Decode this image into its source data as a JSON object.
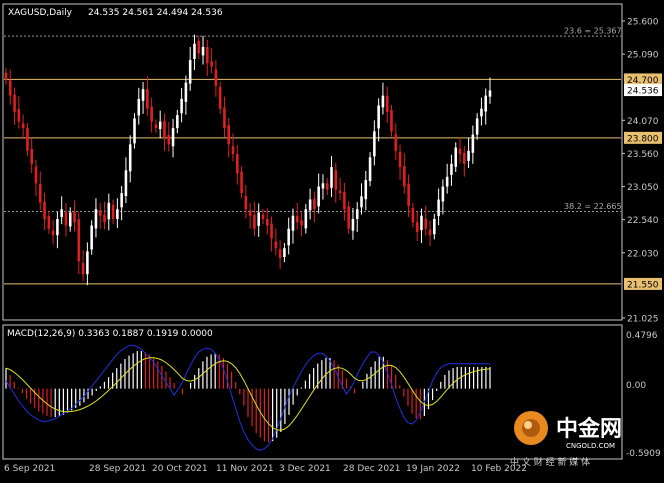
{
  "header": {
    "symbol": "XAGUSD,Daily",
    "ohlc": "24.535 24.561 24.494 24.536"
  },
  "macd": {
    "label": "MACD(12,26,9) 0.3363 0.1887 0.1919 0.0000",
    "axis_top": "0.4796",
    "axis_zero": "0.00",
    "axis_bottom": "-0.5909"
  },
  "chart_data": {
    "type": "candlestick",
    "price_axis_ticks": [
      "25.600",
      "25.090",
      "24.070",
      "23.560",
      "23.050",
      "22.540",
      "22.030",
      "21.025"
    ],
    "ylim": [
      21.025,
      25.6
    ],
    "x_ticks": [
      "6 Sep 2021",
      "28 Sep 2021",
      "20 Oct 2021",
      "11 Nov 2021",
      "3 Dec 2021",
      "28 Dec 2021",
      "19 Jan 2022",
      "10 Feb 2022"
    ],
    "levels": [
      {
        "label": "24.700",
        "value": 24.7,
        "style": "solid",
        "color": "#e8c070"
      },
      {
        "label": "23.800",
        "value": 23.8,
        "style": "solid",
        "color": "#e8c070"
      },
      {
        "label": "21.550",
        "value": 21.55,
        "style": "solid",
        "color": "#e8c070"
      },
      {
        "label": "23.6 = 25.367",
        "value": 25.367,
        "style": "dashed",
        "color": "#9a9a9a"
      },
      {
        "label": "38.2 = 22.665",
        "value": 22.665,
        "style": "dashed",
        "color": "#9a9a9a"
      }
    ],
    "current_price": {
      "label": "24.536",
      "value": 24.536
    },
    "close_series": [
      24.7,
      24.45,
      24.2,
      24.05,
      23.95,
      23.6,
      23.4,
      23.1,
      22.8,
      22.55,
      22.4,
      22.3,
      22.55,
      22.7,
      22.45,
      22.65,
      22.5,
      21.9,
      21.7,
      22.05,
      22.45,
      22.7,
      22.6,
      22.5,
      22.8,
      22.55,
      22.7,
      22.95,
      23.3,
      23.7,
      24.1,
      24.4,
      24.55,
      24.25,
      24.05,
      23.95,
      24.05,
      23.8,
      23.7,
      23.95,
      24.15,
      24.4,
      24.65,
      25.0,
      25.25,
      25.1,
      25.2,
      24.95,
      24.9,
      24.6,
      24.25,
      23.95,
      23.7,
      23.55,
      23.25,
      22.95,
      22.7,
      22.6,
      22.4,
      22.65,
      22.55,
      22.45,
      22.25,
      22.1,
      21.95,
      22.1,
      22.4,
      22.6,
      22.5,
      22.45,
      22.7,
      22.85,
      22.7,
      23.05,
      23.1,
      23.0,
      23.35,
      23.0,
      22.95,
      22.7,
      22.4,
      22.55,
      22.7,
      22.9,
      23.15,
      23.5,
      23.9,
      24.3,
      24.45,
      24.2,
      23.9,
      23.6,
      23.35,
      23.05,
      22.75,
      22.5,
      22.35,
      22.6,
      22.4,
      22.3,
      22.55,
      22.85,
      23.05,
      23.2,
      23.4,
      23.65,
      23.55,
      23.4,
      23.6,
      23.85,
      24.1,
      24.25,
      24.45,
      24.53
    ],
    "macd_hist_range": [
      -0.5909,
      0.4796
    ],
    "macd_hist": [
      0.18,
      0.12,
      0.06,
      0.01,
      -0.04,
      -0.09,
      -0.13,
      -0.17,
      -0.2,
      -0.22,
      -0.24,
      -0.25,
      -0.25,
      -0.24,
      -0.23,
      -0.21,
      -0.19,
      -0.17,
      -0.15,
      -0.12,
      -0.09,
      -0.06,
      -0.02,
      0.02,
      0.06,
      0.1,
      0.14,
      0.18,
      0.22,
      0.26,
      0.29,
      0.31,
      0.33,
      0.33,
      0.32,
      0.3,
      0.27,
      0.24,
      0.2,
      0.15,
      0.1,
      0.05,
      0.0,
      -0.05,
      0.0,
      0.05,
      0.12,
      0.18,
      0.24,
      0.28,
      0.3,
      0.31,
      0.3,
      0.27,
      0.22,
      0.15,
      0.06,
      -0.05,
      -0.15,
      -0.25,
      -0.33,
      -0.39,
      -0.43,
      -0.46,
      -0.47,
      -0.46,
      -0.43,
      -0.38,
      -0.31,
      -0.23,
      -0.14,
      -0.06,
      0.01,
      0.07,
      0.13,
      0.18,
      0.22,
      0.25,
      0.27,
      0.27,
      0.25,
      0.21,
      0.16,
      0.09,
      0.02,
      -0.04,
      0.0,
      0.06,
      0.13,
      0.19,
      0.24,
      0.28,
      0.28,
      0.25,
      0.2,
      0.12,
      0.03,
      -0.07,
      -0.15,
      -0.22,
      -0.26,
      -0.27,
      -0.24,
      -0.18,
      -0.1,
      -0.02,
      0.06,
      0.12,
      0.16,
      0.18,
      0.19,
      0.19,
      0.19,
      0.19,
      0.19,
      0.19,
      0.19,
      0.19,
      0.19
    ]
  },
  "watermark": {
    "brand": "中金网",
    "url": "CNGOLD.COM",
    "tagline": "中 文 财 经 新 媒 体"
  },
  "colors": {
    "bull": "#ffffff",
    "bear": "#e02020",
    "level": "#e8c070",
    "macd_line": "#2030e0",
    "signal_line": "#e0e020",
    "axis": "#c8c8c8"
  }
}
